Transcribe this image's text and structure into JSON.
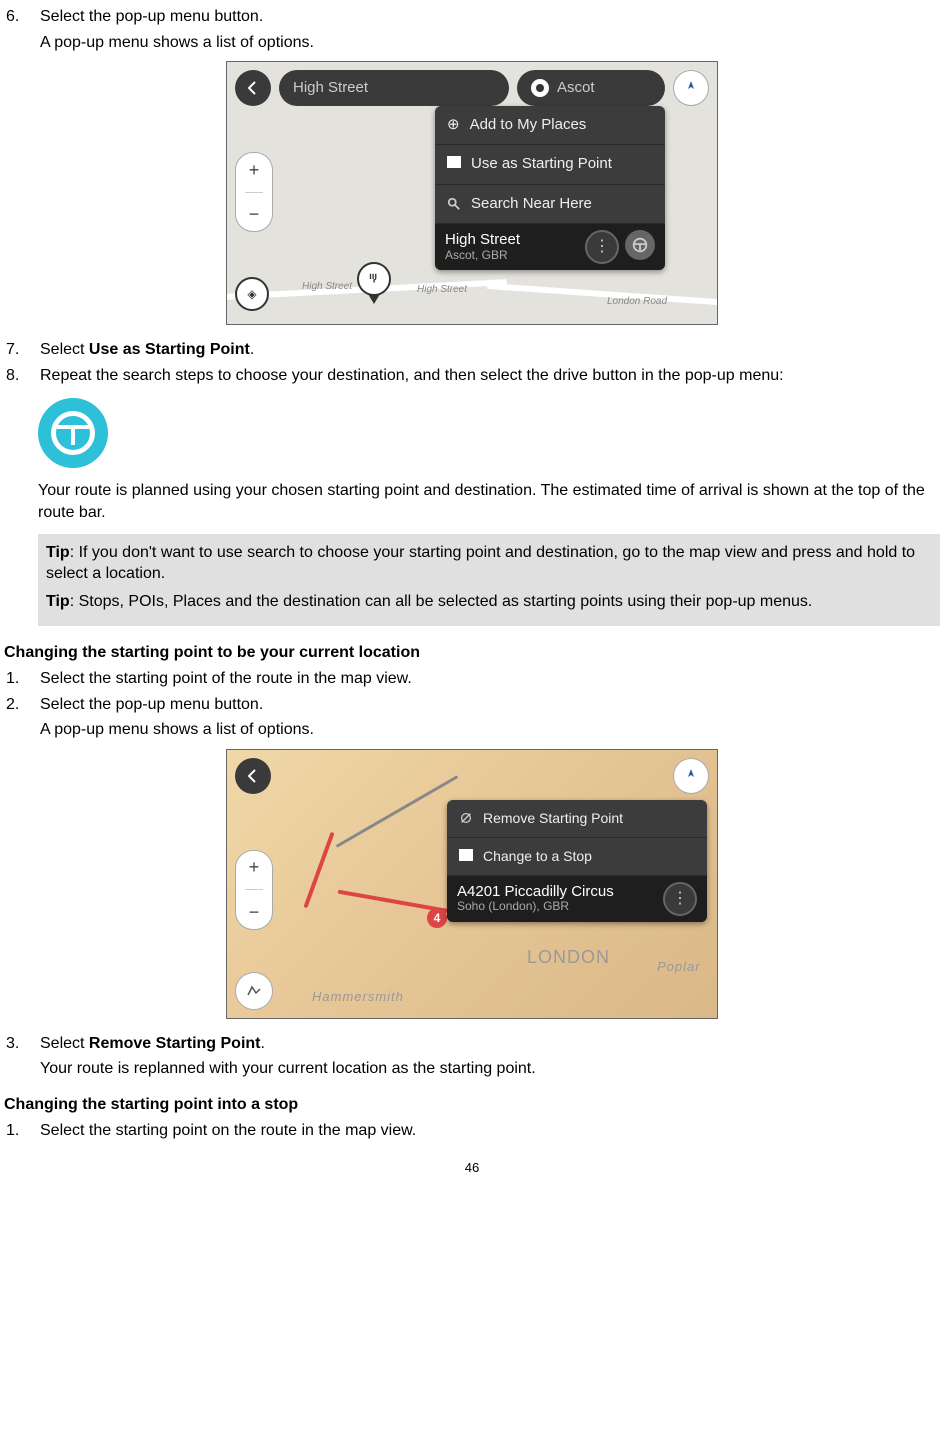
{
  "steps_top": {
    "s6": {
      "num": "6.",
      "line1": "Select the pop-up menu button.",
      "line2": "A pop-up menu shows a list of options."
    },
    "s7": {
      "num": "7.",
      "prefix": "Select ",
      "bold": "Use as Starting Point",
      "suffix": "."
    },
    "s8": {
      "num": "8.",
      "line1": "Repeat the search steps to choose your destination, and then select the drive button in the pop-up menu:",
      "line3": "Your route is planned using your chosen starting point and destination. The estimated time of arrival is shown at the top of the route bar."
    }
  },
  "tips": {
    "t1_label": "Tip",
    "t1_text": ": If you don't want to use search to choose your starting point and destination, go to the map view and press and hold to select a location.",
    "t2_label": "Tip",
    "t2_text": ": Stops, POIs, Places and the destination can all be selected as starting points using their pop-up menus."
  },
  "section1": {
    "heading": "Changing the starting point to be your current location"
  },
  "steps_mid": {
    "s1": {
      "num": "1.",
      "line1": "Select the starting point of the route in the map view."
    },
    "s2": {
      "num": "2.",
      "line1": "Select the pop-up menu button.",
      "line2": "A pop-up menu shows a list of options."
    },
    "s3": {
      "num": "3.",
      "prefix": "Select ",
      "bold": "Remove Starting Point",
      "suffix": ".",
      "line2": "Your route is replanned with your current location as the starting point."
    }
  },
  "section2": {
    "heading": "Changing the starting point into a stop"
  },
  "steps_bot": {
    "s1": {
      "num": "1.",
      "line1": "Select the starting point on the route in the map view."
    }
  },
  "fig1": {
    "search_left": "High Street",
    "search_right": "Ascot",
    "menu": {
      "opt1": "Add to My Places",
      "opt2": "Use as Starting Point",
      "opt3": "Search Near Here",
      "title": "High Street",
      "sub": "Ascot, GBR"
    },
    "roads": {
      "r1": "High Street",
      "r2": "High Street",
      "r3": "London Road"
    },
    "zoom_plus": "+",
    "zoom_minus": "−"
  },
  "fig2": {
    "menu": {
      "opt1": "Remove Starting Point",
      "opt2": "Change to a Stop",
      "title": "A4201 Piccadilly Circus",
      "sub": "Soho (London), GBR"
    },
    "labels": {
      "london": "LONDON",
      "hammersmith": "Hammersmith",
      "poplar": "Poplar"
    },
    "badge": "4",
    "zoom_plus": "+",
    "zoom_minus": "−"
  },
  "page_number": "46"
}
